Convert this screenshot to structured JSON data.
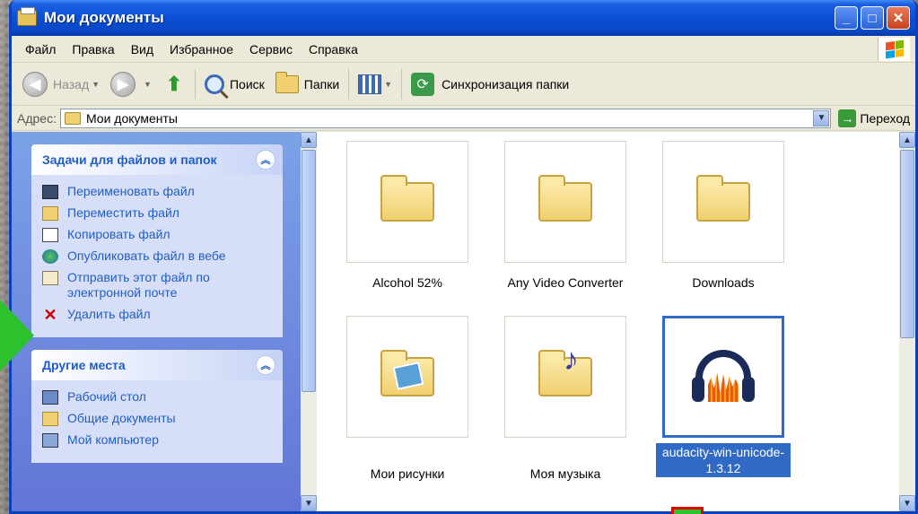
{
  "window": {
    "title": "Мои документы"
  },
  "menu": [
    "Файл",
    "Правка",
    "Вид",
    "Избранное",
    "Сервис",
    "Справка"
  ],
  "toolbar": {
    "back_label": "Назад",
    "search_label": "Поиск",
    "folders_label": "Папки",
    "sync_label": "Синхронизация папки"
  },
  "address": {
    "label": "Адрес:",
    "value": "Мои документы",
    "go_label": "Переход"
  },
  "tasks_panel": {
    "title": "Задачи для файлов и папок",
    "items": [
      {
        "label": "Переименовать файл",
        "icon": "rename-icon"
      },
      {
        "label": "Переместить файл",
        "icon": "move-icon"
      },
      {
        "label": "Копировать файл",
        "icon": "copy-icon"
      },
      {
        "label": "Опубликовать файл в вебе",
        "icon": "globe-icon"
      },
      {
        "label": "Отправить этот файл по электронной почте",
        "icon": "email-icon"
      },
      {
        "label": "Удалить файл",
        "icon": "delete-icon"
      }
    ]
  },
  "places_panel": {
    "title": "Другие места",
    "items": [
      {
        "label": "Рабочий стол",
        "icon": "desktop-icon"
      },
      {
        "label": "Общие документы",
        "icon": "folder-icon"
      },
      {
        "label": "Мой компьютер",
        "icon": "computer-icon"
      }
    ]
  },
  "files": [
    {
      "name": "Alcohol 52%",
      "icon": "folder-icon"
    },
    {
      "name": "Any Video Converter",
      "icon": "folder-icon"
    },
    {
      "name": "Downloads",
      "icon": "folder-icon"
    },
    {
      "name": "Мои рисунки",
      "icon": "pictures-folder-icon"
    },
    {
      "name": "Моя музыка",
      "icon": "music-folder-icon"
    },
    {
      "name": "audacity-win-unicode-1.3.12",
      "icon": "audacity-icon",
      "selected": true
    }
  ],
  "colors": {
    "titlebar": "#0a4fd6",
    "taskpane": "#7ba2e7",
    "selection": "#316ac5",
    "link": "#215dc6"
  }
}
